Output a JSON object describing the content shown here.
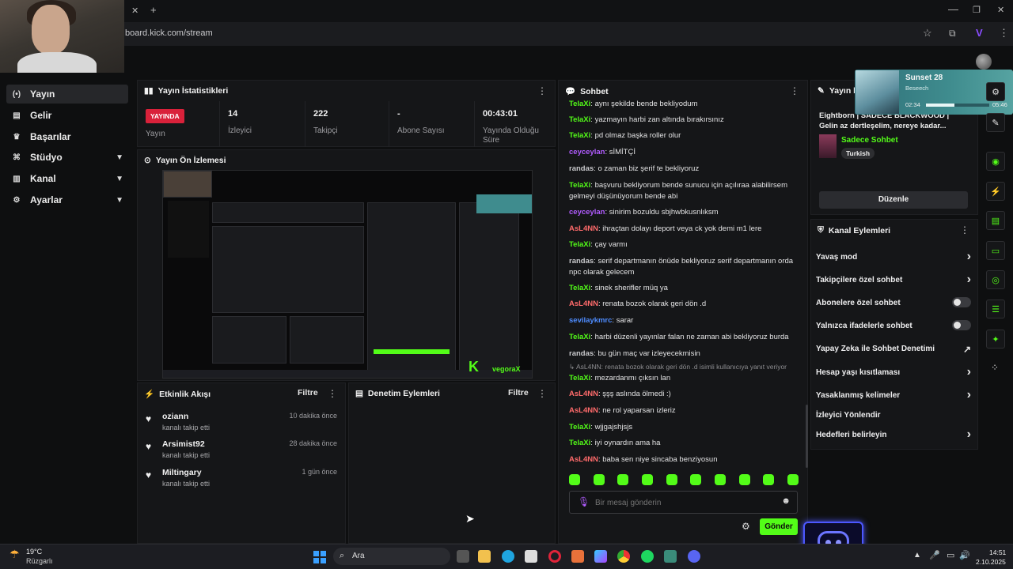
{
  "browser": {
    "url": "board.kick.com/stream",
    "close_tab": "✕",
    "new_tab": "+"
  },
  "sidebar": {
    "items": [
      {
        "label": "Yayın",
        "icon": "broadcast-icon",
        "glyph": "(•)"
      },
      {
        "label": "Gelir",
        "icon": "revenue-icon",
        "glyph": "▤"
      },
      {
        "label": "Başarılar",
        "icon": "trophy-icon",
        "glyph": "🏆"
      },
      {
        "label": "Stüdyo",
        "icon": "studio-icon",
        "glyph": "⌘"
      },
      {
        "label": "Kanal",
        "icon": "channel-icon",
        "glyph": "▥"
      },
      {
        "label": "Ayarlar",
        "icon": "settings-icon",
        "glyph": "⚙"
      }
    ]
  },
  "stats_panel": {
    "title": "Yayın İstatistikleri",
    "live_badge": "YAYINDA",
    "live_label": "Yayın",
    "stats": [
      {
        "value": "14",
        "label": "İzleyici"
      },
      {
        "value": "222",
        "label": "Takipçi"
      },
      {
        "value": "-",
        "label": "Abone Sayısı"
      },
      {
        "value": "00:43:01",
        "label": "Yayında Olduğu Süre"
      }
    ]
  },
  "preview_panel": {
    "title": "Yayın Ön İzlemesi"
  },
  "activity_panel": {
    "title": "Etkinlik Akışı",
    "filter": "Filtre",
    "items": [
      {
        "user": "oziann",
        "action": "kanalı takip etti",
        "time": "10 dakika önce"
      },
      {
        "user": "Arsimist92",
        "action": "kanalı takip etti",
        "time": "28 dakika önce"
      },
      {
        "user": "Miltingary",
        "action": "kanalı takip etti",
        "time": "1 gün önce"
      }
    ]
  },
  "moderation_panel": {
    "title": "Denetim Eylemleri",
    "filter": "Filtre"
  },
  "chat": {
    "title": "Sohbet",
    "messages": [
      {
        "user": "TelaXi",
        "text": "aynı şekilde bende bekliyodum",
        "color": "#53fc18"
      },
      {
        "user": "TelaXi",
        "text": "yazmayın harbi zan altında bırakırsınız",
        "color": "#53fc18"
      },
      {
        "user": "TelaXi",
        "text": "pd olmaz başka roller olur",
        "color": "#53fc18"
      },
      {
        "user": "ceyceylan",
        "text": "sİMİTÇİ",
        "color": "#b15cff"
      },
      {
        "user": "randas",
        "text": "o zaman biz şerif te bekliyoruz",
        "color": "#c9c9cc"
      },
      {
        "user": "TelaXi",
        "text": "başvuru bekliyorum bende sunucu için açılıraa alabilirsem gelmeyi düşünüyorum bende abi",
        "color": "#53fc18"
      },
      {
        "user": "ceyceylan",
        "text": "sinirim bozuldu sbjhwbkusnlıksm",
        "color": "#b15cff"
      },
      {
        "user": "AsL4NN",
        "text": "ihraçtan dolayı deport veya ck yok demi m1 lere",
        "color": "#ff6b6b"
      },
      {
        "user": "TelaXi",
        "text": "çay varmı",
        "color": "#53fc18"
      },
      {
        "user": "randas",
        "text": "serif departmanın önüde bekliyoruz serif departmanın orda npc olarak gelecem",
        "color": "#c9c9cc"
      },
      {
        "user": "TelaXi",
        "text": "sinek sherifler müq ya",
        "color": "#53fc18"
      },
      {
        "user": "AsL4NN",
        "text": "renata bozok olarak geri dön .d",
        "color": "#ff6b6b"
      },
      {
        "user": "sevilaykmrc",
        "text": "sarar",
        "color": "#4e8cff"
      },
      {
        "user": "TelaXi",
        "text": "harbi düzenli yayınlar falan ne zaman abi bekliyoruz burda",
        "color": "#53fc18"
      },
      {
        "user": "randas",
        "text": "bu gün maç var izleyecekmisin",
        "color": "#c9c9cc"
      }
    ],
    "reply_context": "↳ AsL4NN: renata bozok olarak geri dön .d isimli kullanıcıya yanıt veriyor",
    "messages2": [
      {
        "user": "TelaXi",
        "text": "mezardanmı çıksın lan",
        "color": "#53fc18"
      },
      {
        "user": "AsL4NN",
        "text": "şşş aslında ölmedi :)",
        "color": "#ff6b6b"
      },
      {
        "user": "AsL4NN",
        "text": "ne rol yaparsan izleriz",
        "color": "#ff6b6b"
      },
      {
        "user": "TelaXi",
        "text": "wjjgajshjsjs",
        "color": "#53fc18"
      },
      {
        "user": "TelaXi",
        "text": "iyi oynardın ama ha",
        "color": "#53fc18"
      },
      {
        "user": "AsL4NN",
        "text": "baba sen niye sincaba benziyosun",
        "color": "#ff6b6b"
      }
    ],
    "input_placeholder": "Bir mesaj gönderin",
    "send_label": "Gönder"
  },
  "stream_info": {
    "title_prefix": "Yayın b",
    "stream_title": "Eightborn | SADECE BLACKWOOD | Gelin az dertleşelim, nereye kadar...",
    "category": "Sadece Sohbet",
    "language": "Turkish",
    "edit_label": "Düzenle"
  },
  "channel_actions": {
    "title": "Kanal Eylemleri",
    "items": [
      {
        "label": "Yavaş mod",
        "control": "arrow"
      },
      {
        "label": "Takipçilere özel sohbet",
        "control": "arrow"
      },
      {
        "label": "Abonelere özel sohbet",
        "control": "toggle"
      },
      {
        "label": "Yalnızca ifadelerle sohbet",
        "control": "toggle"
      },
      {
        "label": "Yapay Zeka ile Sohbet Denetimi",
        "control": "external"
      },
      {
        "label": "Hesap yaşı kısıtlaması",
        "control": "arrow"
      },
      {
        "label": "Yasaklanmış kelimeler",
        "control": "arrow"
      },
      {
        "label": "İzleyici Yönlendir",
        "control": "none"
      },
      {
        "label": "Hedefleri belirleyin",
        "control": "arrow"
      }
    ]
  },
  "music_widget": {
    "track": "Sunset 28",
    "artist": "Beseech",
    "elapsed": "02:34",
    "total": "05:46",
    "progress": 0.45
  },
  "taskbar": {
    "weather_temp": "19°C",
    "weather_desc": "Rüzgarlı",
    "search_label": "Ara",
    "time": "14:51",
    "date": "2.10.2025"
  },
  "preview_mini": {
    "logo_k": "K",
    "logo_text": "vegoraX"
  }
}
